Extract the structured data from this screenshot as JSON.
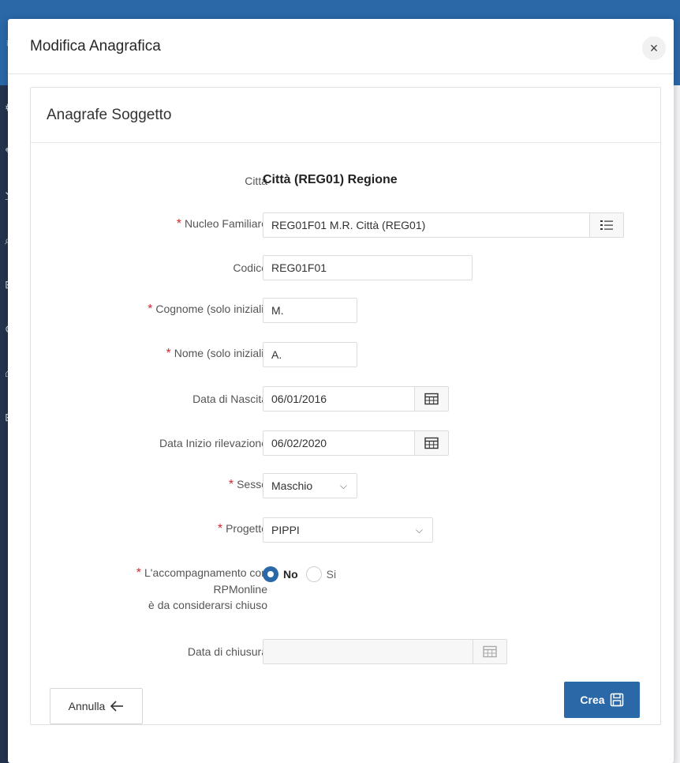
{
  "dialog": {
    "title": "Modifica Anagrafica",
    "close_icon": "close-icon"
  },
  "region": {
    "title": "Anagrafe Soggetto"
  },
  "form": {
    "citta": {
      "label": "Città",
      "value": "Città (REG01) Regione"
    },
    "nucleo": {
      "label": "Nucleo Familiare",
      "value": "REG01F01 M.R. Città (REG01)",
      "icon": "list-icon",
      "required": true
    },
    "codice": {
      "label": "Codice",
      "value": "REG01F01"
    },
    "cognome": {
      "label": "Cognome (solo iniziali)",
      "value": "M.",
      "required": true
    },
    "nome": {
      "label": "Nome (solo iniziali)",
      "value": "A.",
      "required": true
    },
    "data_nascita": {
      "label": "Data di Nascita",
      "value": "06/01/2016",
      "icon": "calendar-icon"
    },
    "data_inizio": {
      "label": "Data Inizio rilevazione",
      "value": "06/02/2020",
      "icon": "calendar-icon"
    },
    "sesso": {
      "label": "Sesso",
      "value": "Maschio",
      "required": true
    },
    "progetto": {
      "label": "Progetto",
      "value": "PIPPI",
      "required": true
    },
    "accompagnamento": {
      "label_line1": "L'accompagnamento con",
      "label_line2": "RPMonline",
      "label_line3": "è da considerarsi chiuso",
      "option_no": "No",
      "option_si": "Si",
      "selected": "No",
      "required": true
    },
    "data_chiusura": {
      "label": "Data di chiusura",
      "value": "",
      "icon": "calendar-icon"
    }
  },
  "buttons": {
    "annulla": "Annulla",
    "crea": "Crea"
  },
  "colors": {
    "primary": "#2a68a8",
    "required": "#d0282e"
  }
}
